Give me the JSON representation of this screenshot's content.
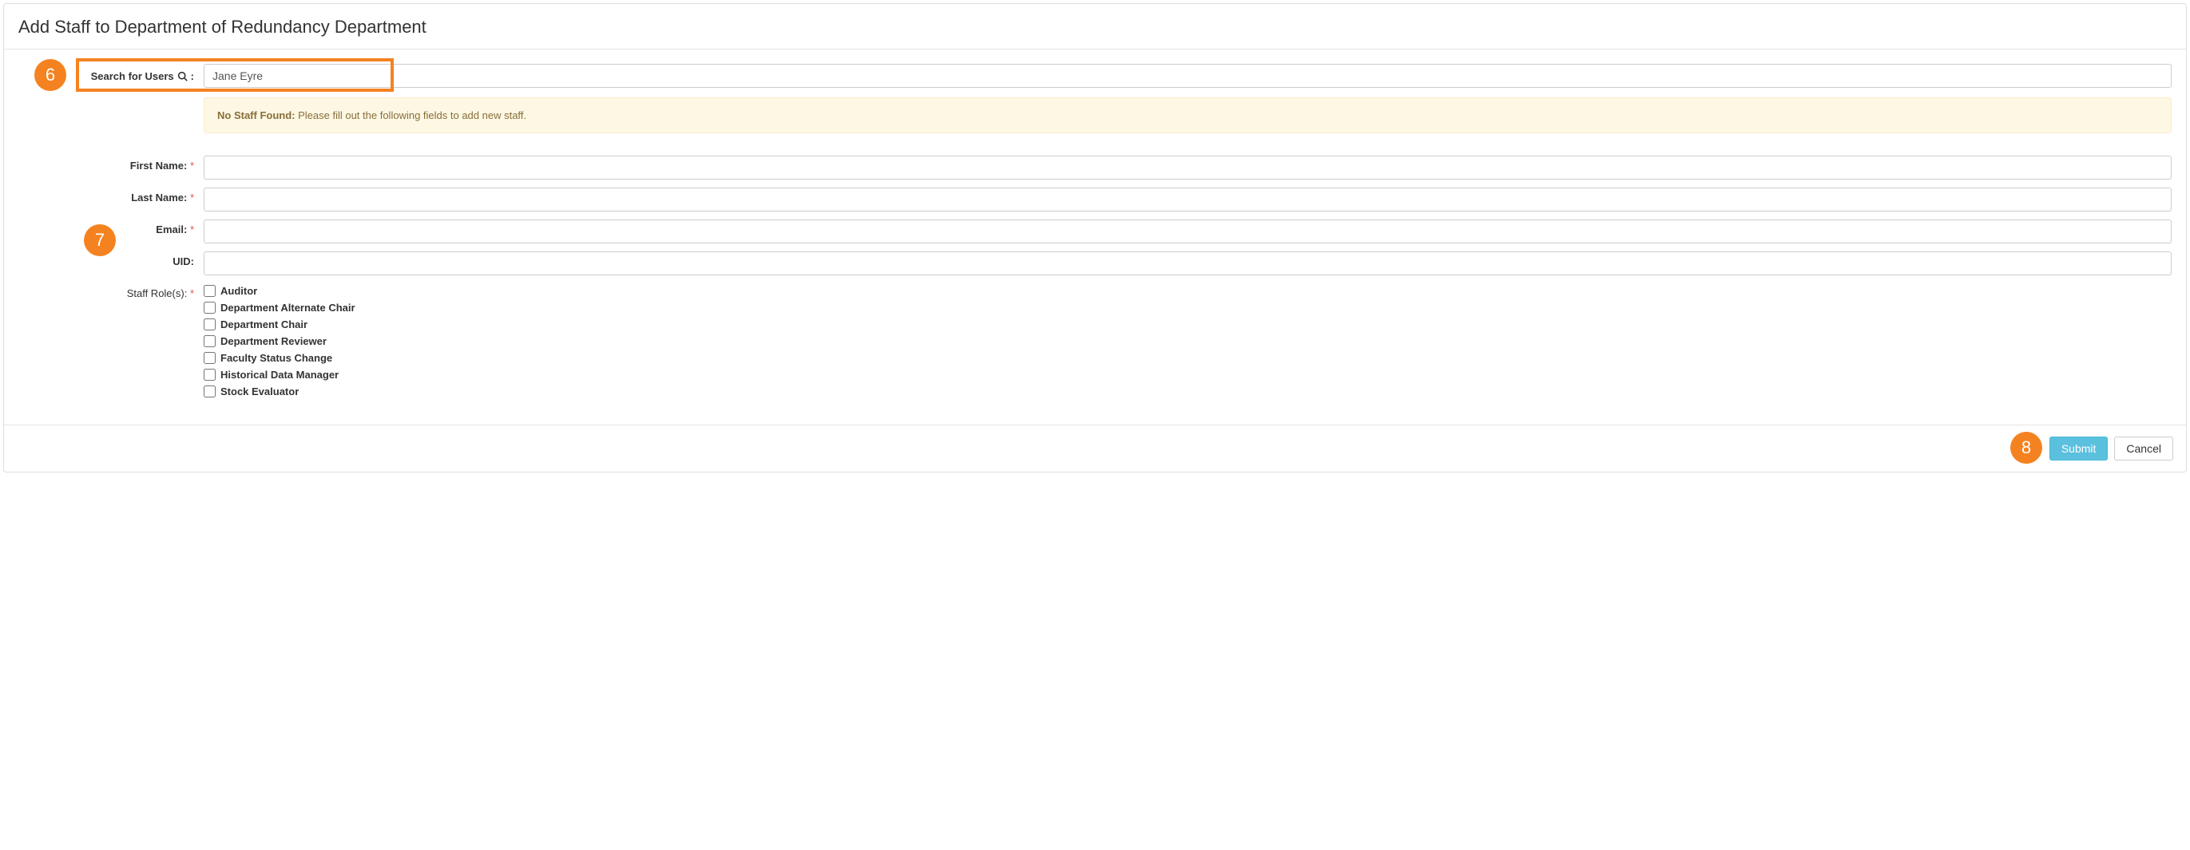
{
  "modal": {
    "title": "Add Staff to Department of Redundancy Department"
  },
  "search": {
    "label": "Search for Users",
    "value": "Jane Eyre"
  },
  "alert": {
    "strong": "No Staff Found:",
    "text": " Please fill out the following fields to add new staff."
  },
  "fields": {
    "first_name": {
      "label": "First Name:",
      "required": true,
      "value": ""
    },
    "last_name": {
      "label": "Last Name:",
      "required": true,
      "value": ""
    },
    "email": {
      "label": "Email:",
      "required": true,
      "value": ""
    },
    "uid": {
      "label": "UID:",
      "required": false,
      "value": ""
    }
  },
  "roles": {
    "label": "Staff Role(s):",
    "required": true,
    "options": [
      "Auditor",
      "Department Alternate Chair",
      "Department Chair",
      "Department Reviewer",
      "Faculty Status Change",
      "Historical Data Manager",
      "Stock Evaluator"
    ]
  },
  "footer": {
    "submit": "Submit",
    "cancel": "Cancel"
  },
  "annotations": {
    "badge6": "6",
    "badge7": "7",
    "badge8": "8"
  },
  "req_marker": "*"
}
